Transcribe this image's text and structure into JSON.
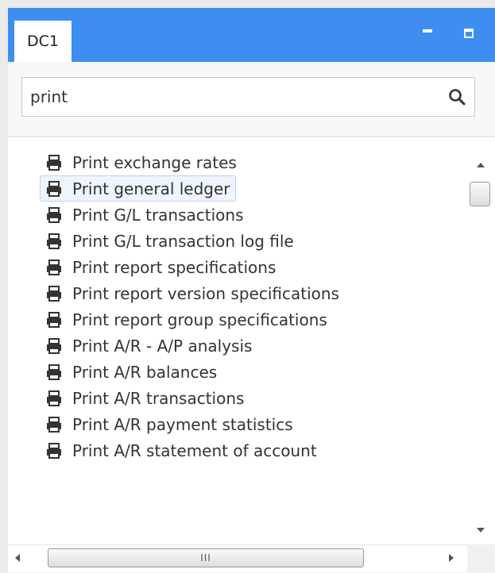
{
  "window": {
    "tab_label": "DC1",
    "accent_color": "#3d8ef0"
  },
  "search": {
    "value": "print",
    "icon": "search-icon"
  },
  "list": {
    "item_icon": "printer-icon",
    "selected_index": 1,
    "items": [
      {
        "label": "Print exchange rates"
      },
      {
        "label": "Print general ledger"
      },
      {
        "label": "Print G/L transactions"
      },
      {
        "label": "Print G/L transaction log file"
      },
      {
        "label": "Print report specifications"
      },
      {
        "label": "Print report version specifications"
      },
      {
        "label": "Print report group specifications"
      },
      {
        "label": "Print A/R - A/P analysis"
      },
      {
        "label": "Print A/R balances"
      },
      {
        "label": "Print A/R transactions"
      },
      {
        "label": "Print A/R payment statistics"
      },
      {
        "label": "Print A/R statement of account"
      }
    ]
  },
  "scrollbar": {
    "grip": "III"
  }
}
